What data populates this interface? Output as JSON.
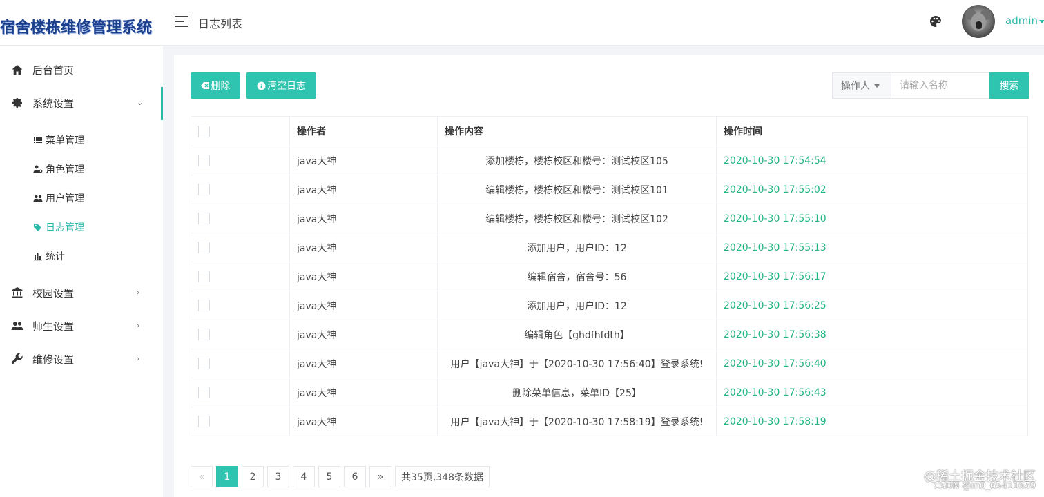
{
  "app": {
    "logo_text": "宿舍楼栋维修管理系统",
    "page_title": "日志列表",
    "user": "admin"
  },
  "sidebar": {
    "home": "后台首页",
    "system": "系统设置",
    "sub": [
      "菜单管理",
      "角色管理",
      "用户管理",
      "日志管理",
      "统计"
    ],
    "campus": "校园设置",
    "teachers": "师生设置",
    "repair": "维修设置"
  },
  "toolbar": {
    "delete_label": "删除",
    "clear_label": "清空日志"
  },
  "search": {
    "select_label": "操作人",
    "placeholder": "请输入名称",
    "button_label": "搜索"
  },
  "table": {
    "headers": [
      "操作者",
      "操作内容",
      "操作时间"
    ],
    "rows": [
      {
        "op": "java大神",
        "content": "添加楼栋，楼栋校区和楼号：测试校区105",
        "time": "2020-10-30 17:54:54"
      },
      {
        "op": "java大神",
        "content": "编辑楼栋，楼栋校区和楼号：测试校区101",
        "time": "2020-10-30 17:55:02"
      },
      {
        "op": "java大神",
        "content": "编辑楼栋，楼栋校区和楼号：测试校区102",
        "time": "2020-10-30 17:55:10"
      },
      {
        "op": "java大神",
        "content": "添加用户，用户ID：12",
        "time": "2020-10-30 17:55:13"
      },
      {
        "op": "java大神",
        "content": "编辑宿舍，宿舍号：56",
        "time": "2020-10-30 17:56:17"
      },
      {
        "op": "java大神",
        "content": "添加用户，用户ID：12",
        "time": "2020-10-30 17:56:25"
      },
      {
        "op": "java大神",
        "content": "编辑角色【ghdfhfdth】",
        "time": "2020-10-30 17:56:38"
      },
      {
        "op": "java大神",
        "content": "用户【java大神】于【2020-10-30 17:56:40】登录系统!",
        "time": "2020-10-30 17:56:40"
      },
      {
        "op": "java大神",
        "content": "删除菜单信息，菜单ID【25】",
        "time": "2020-10-30 17:56:43"
      },
      {
        "op": "java大神",
        "content": "用户【java大神】于【2020-10-30 17:58:19】登录系统!",
        "time": "2020-10-30 17:58:19"
      }
    ]
  },
  "pager": {
    "prev": "«",
    "pages": [
      "1",
      "2",
      "3",
      "4",
      "5",
      "6"
    ],
    "next": "»",
    "summary": "共35页,348条数据",
    "current": "1"
  },
  "watermark": {
    "line1": "@稀土掘金技术社区",
    "line2": "CSDN @m0_65411659"
  },
  "colors": {
    "accent": "#2ec4b0",
    "time_text": "#21b47f",
    "logo": "#1c3f8c"
  }
}
